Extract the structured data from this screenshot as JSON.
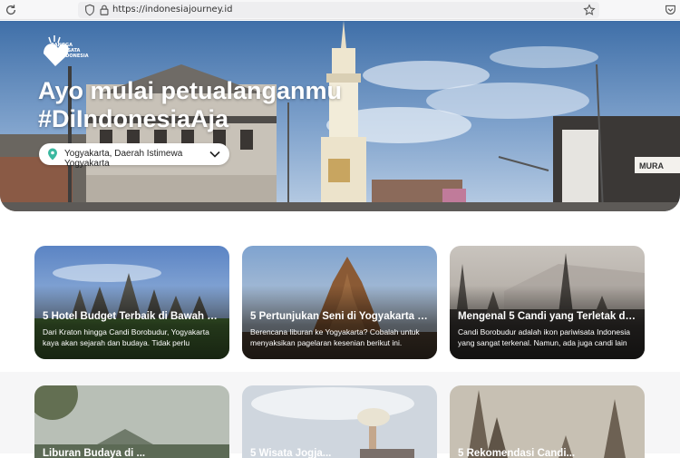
{
  "browser": {
    "url": "https://indonesiajourney.id"
  },
  "hero": {
    "logo_text": "BANGGA BERWISATA #DIINDONESIA",
    "headline_line1": "Ayo mulai petualanganmu",
    "headline_line2": "#DiIndonesiaAja",
    "location": "Yogyakarta, Daerah Istimewa Yogyakarta",
    "shop_sign": "MURA"
  },
  "cards": [
    {
      "title": "5 Hotel Budget Terbaik di Bawah 6...",
      "description": "Dari Kraton hingga Candi Borobudur, Yogyakarta kaya akan sejarah dan budaya. Tidak perlu"
    },
    {
      "title": "5 Pertunjukan Seni di Yogyakarta y...",
      "description": "Berencana liburan ke Yogyakarta? Cobalah untuk menyaksikan pagelaran kesenian berikut ini."
    },
    {
      "title": "Mengenal 5 Candi yang Terletak di ...",
      "description": "Candi Borobudur adalah ikon pariwisata Indonesia yang sangat terkenal. Namun, ada juga candi lain"
    }
  ],
  "cards_row2": [
    {
      "title": "Liburan Budaya di ..."
    },
    {
      "title": "5 Wisata Jogja..."
    },
    {
      "title": "5 Rekomendasi Candi..."
    }
  ],
  "colors": {
    "sky_top": "#3f6fa8",
    "sky_bottom": "#a9c3de",
    "pin": "#3bb8a0"
  }
}
